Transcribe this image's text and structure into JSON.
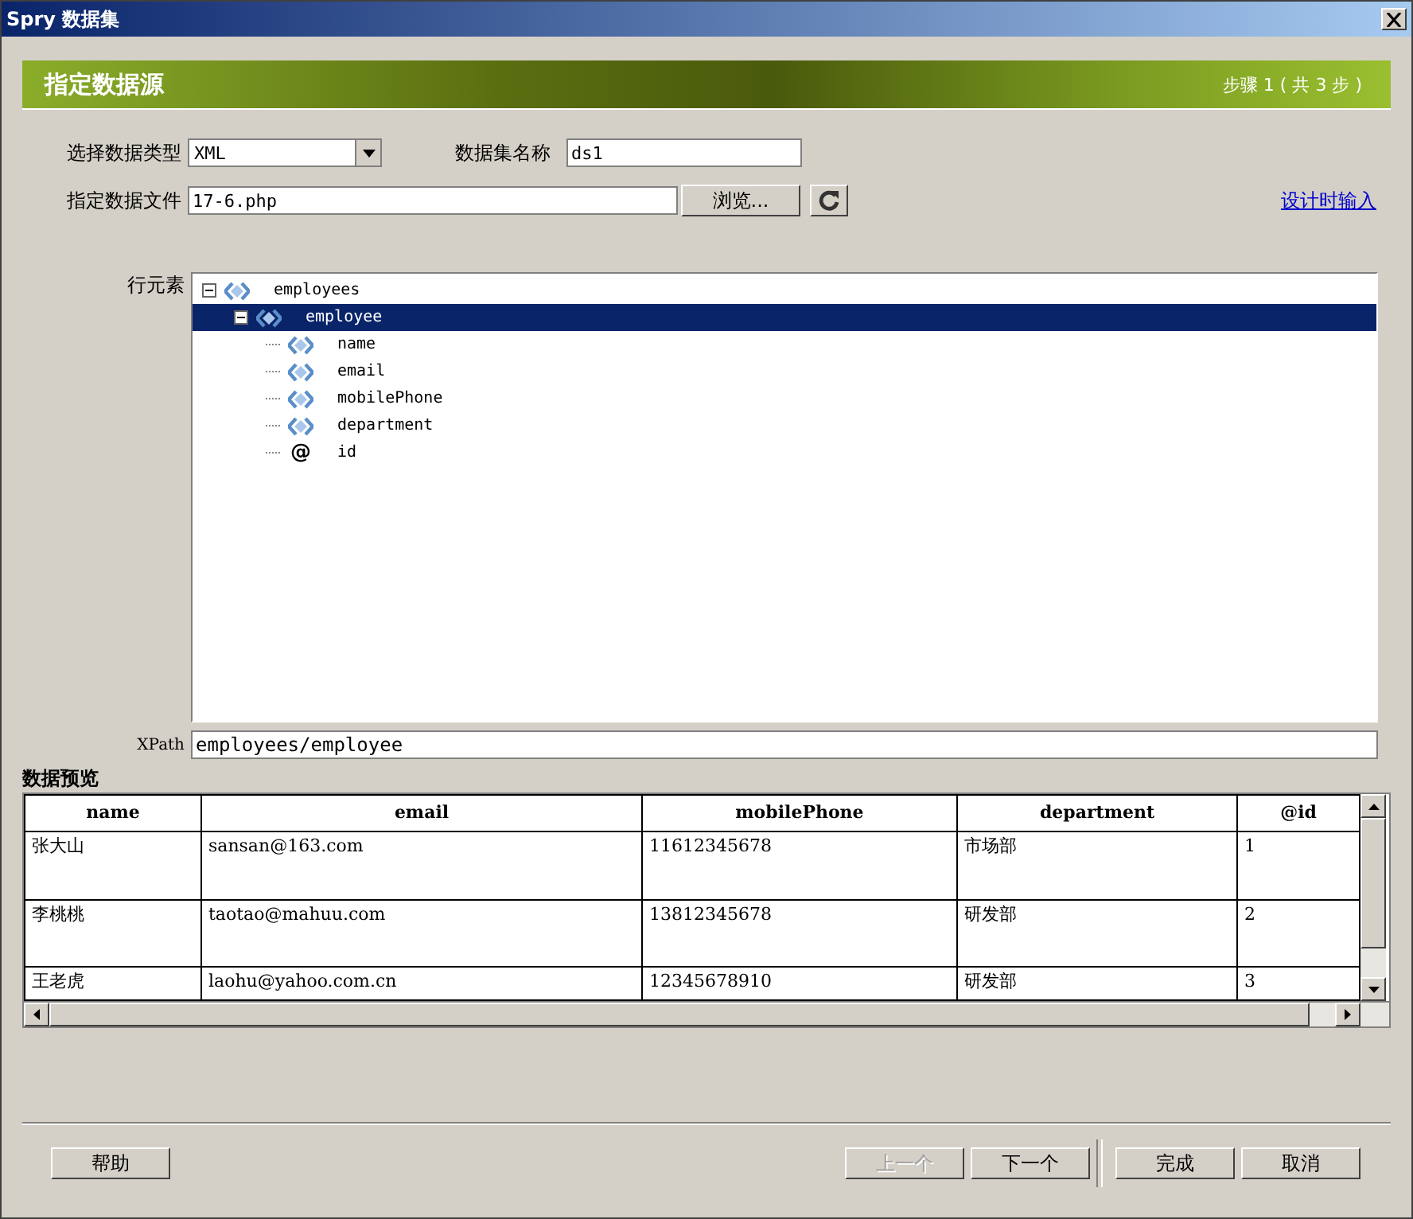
{
  "window": {
    "title": "Spry 数据集"
  },
  "banner": {
    "title": "指定数据源",
    "step": "步骤 1 ( 共 3 步 )"
  },
  "form": {
    "type_label": "选择数据类型",
    "type_value": "XML",
    "name_label": "数据集名称",
    "name_value": "ds1",
    "file_label": "指定数据文件",
    "file_value": "17-6.php",
    "browse": "浏览...",
    "design_link": "设计时输入"
  },
  "tree": {
    "label": "行元素",
    "items": [
      {
        "label": "employees",
        "kind": "element",
        "expanded": true,
        "selected": false,
        "children": [
          {
            "label": "employee",
            "kind": "element",
            "expanded": true,
            "selected": true,
            "children": [
              {
                "label": "name",
                "kind": "element",
                "selected": false
              },
              {
                "label": "email",
                "kind": "element",
                "selected": false
              },
              {
                "label": "mobilePhone",
                "kind": "element",
                "selected": false
              },
              {
                "label": "department",
                "kind": "element",
                "selected": false
              },
              {
                "label": "id",
                "kind": "attribute",
                "icon": "@",
                "selected": false
              }
            ]
          }
        ]
      }
    ]
  },
  "xpath": {
    "label": "XPath",
    "value": "employees/employee"
  },
  "preview": {
    "title": "数据预览",
    "columns": [
      "name",
      "email",
      "mobilePhone",
      "department",
      "@id"
    ],
    "rows": [
      [
        "张大山",
        "sansan@163.com",
        "11612345678",
        "市场部",
        "1"
      ],
      [
        "李桃桃",
        "taotao@mahuu.com",
        "13812345678",
        "研发部",
        "2"
      ],
      [
        "王老虎",
        "laohu@yahoo.com.cn",
        "12345678910",
        "研发部",
        "3"
      ]
    ]
  },
  "buttons": [
    {
      "label": "帮助",
      "disabled": false
    },
    {
      "label": "上一个",
      "disabled": true
    },
    {
      "label": "下一个",
      "disabled": false
    },
    {
      "label": "完成",
      "disabled": false
    },
    {
      "label": "取消",
      "disabled": false
    }
  ]
}
